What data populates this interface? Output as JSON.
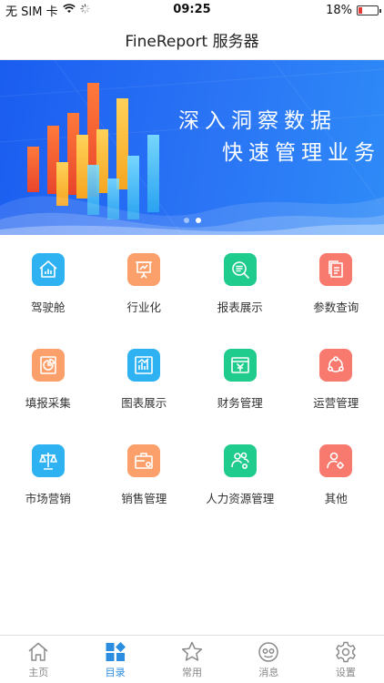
{
  "status_bar": {
    "carrier": "无 SIM 卡",
    "time": "09:25",
    "battery_percent": "18%",
    "battery_level": 0.18,
    "battery_color": "#e53935"
  },
  "nav": {
    "title": "FineReport 服务器"
  },
  "banner": {
    "line1": "深入洞察数据",
    "line2": "快速管理业务",
    "slides": 2,
    "active_slide": 2
  },
  "grid": [
    {
      "label": "驾驶舱",
      "icon": "house-chart-icon",
      "color": "#2fb2f2"
    },
    {
      "label": "行业化",
      "icon": "presentation-board-icon",
      "color": "#fba06a"
    },
    {
      "label": "报表展示",
      "icon": "search-list-icon",
      "color": "#1fcb8d"
    },
    {
      "label": "参数查询",
      "icon": "documents-icon",
      "color": "#f87a6f"
    },
    {
      "label": "填报采集",
      "icon": "pie-chart-icon",
      "color": "#fba06a"
    },
    {
      "label": "图表展示",
      "icon": "bar-chart-icon",
      "color": "#2fb2f2"
    },
    {
      "label": "财务管理",
      "icon": "yen-window-icon",
      "color": "#1fcb8d"
    },
    {
      "label": "运营管理",
      "icon": "cycle-nodes-icon",
      "color": "#f87a6f"
    },
    {
      "label": "市场营销",
      "icon": "scale-icon",
      "color": "#2fb2f2"
    },
    {
      "label": "销售管理",
      "icon": "briefcase-gear-icon",
      "color": "#fba06a"
    },
    {
      "label": "人力资源管理",
      "icon": "people-gear-icon",
      "color": "#1fcb8d"
    },
    {
      "label": "其他",
      "icon": "person-gear-icon",
      "color": "#f87a6f"
    }
  ],
  "tabs": [
    {
      "label": "主页",
      "icon": "home-icon",
      "active": false
    },
    {
      "label": "目录",
      "icon": "catalog-icon",
      "active": true
    },
    {
      "label": "常用",
      "icon": "star-icon",
      "active": false
    },
    {
      "label": "消息",
      "icon": "message-icon",
      "active": false
    },
    {
      "label": "设置",
      "icon": "gear-icon",
      "active": false
    }
  ],
  "colors": {
    "accent": "#2a8de0",
    "inactive": "#888888"
  }
}
